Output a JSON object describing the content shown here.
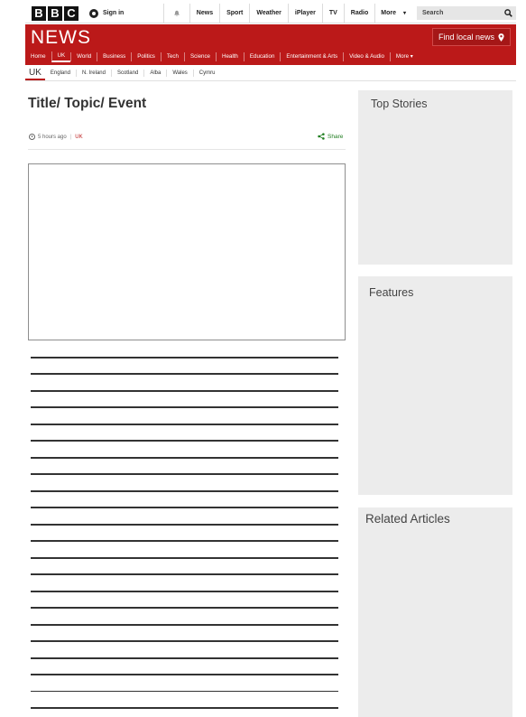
{
  "topbar": {
    "logo_letters": [
      "B",
      "B",
      "C"
    ],
    "signin": "Sign in",
    "nav": [
      "News",
      "Sport",
      "Weather",
      "iPlayer",
      "TV",
      "Radio"
    ],
    "more": "More",
    "search_placeholder": "Search"
  },
  "newsbar": {
    "title": "NEWS",
    "local_button": "Find local news",
    "nav": [
      "Home",
      "UK",
      "World",
      "Business",
      "Politics",
      "Tech",
      "Science",
      "Health",
      "Education",
      "Entertainment & Arts",
      "Video & Audio",
      "More"
    ],
    "active": "UK"
  },
  "subnav": [
    "UK",
    "England",
    "N. Ireland",
    "Scotland",
    "Alba",
    "Wales",
    "Cymru"
  ],
  "article": {
    "title": "Title/ Topic/ Event",
    "time": "5 hours ago",
    "topic": "UK",
    "share": "Share"
  },
  "sidebar": {
    "top_stories": "Top Stories",
    "features": "Features",
    "related": "Related Articles"
  },
  "colors": {
    "brand_red": "#bb1919",
    "share_green": "#1f7d1f",
    "panel_grey": "#ececec"
  },
  "icons": [
    "bbc-logo",
    "user-icon",
    "bell-icon",
    "search-icon",
    "location-pin-icon",
    "clock-icon",
    "share-icon"
  ]
}
